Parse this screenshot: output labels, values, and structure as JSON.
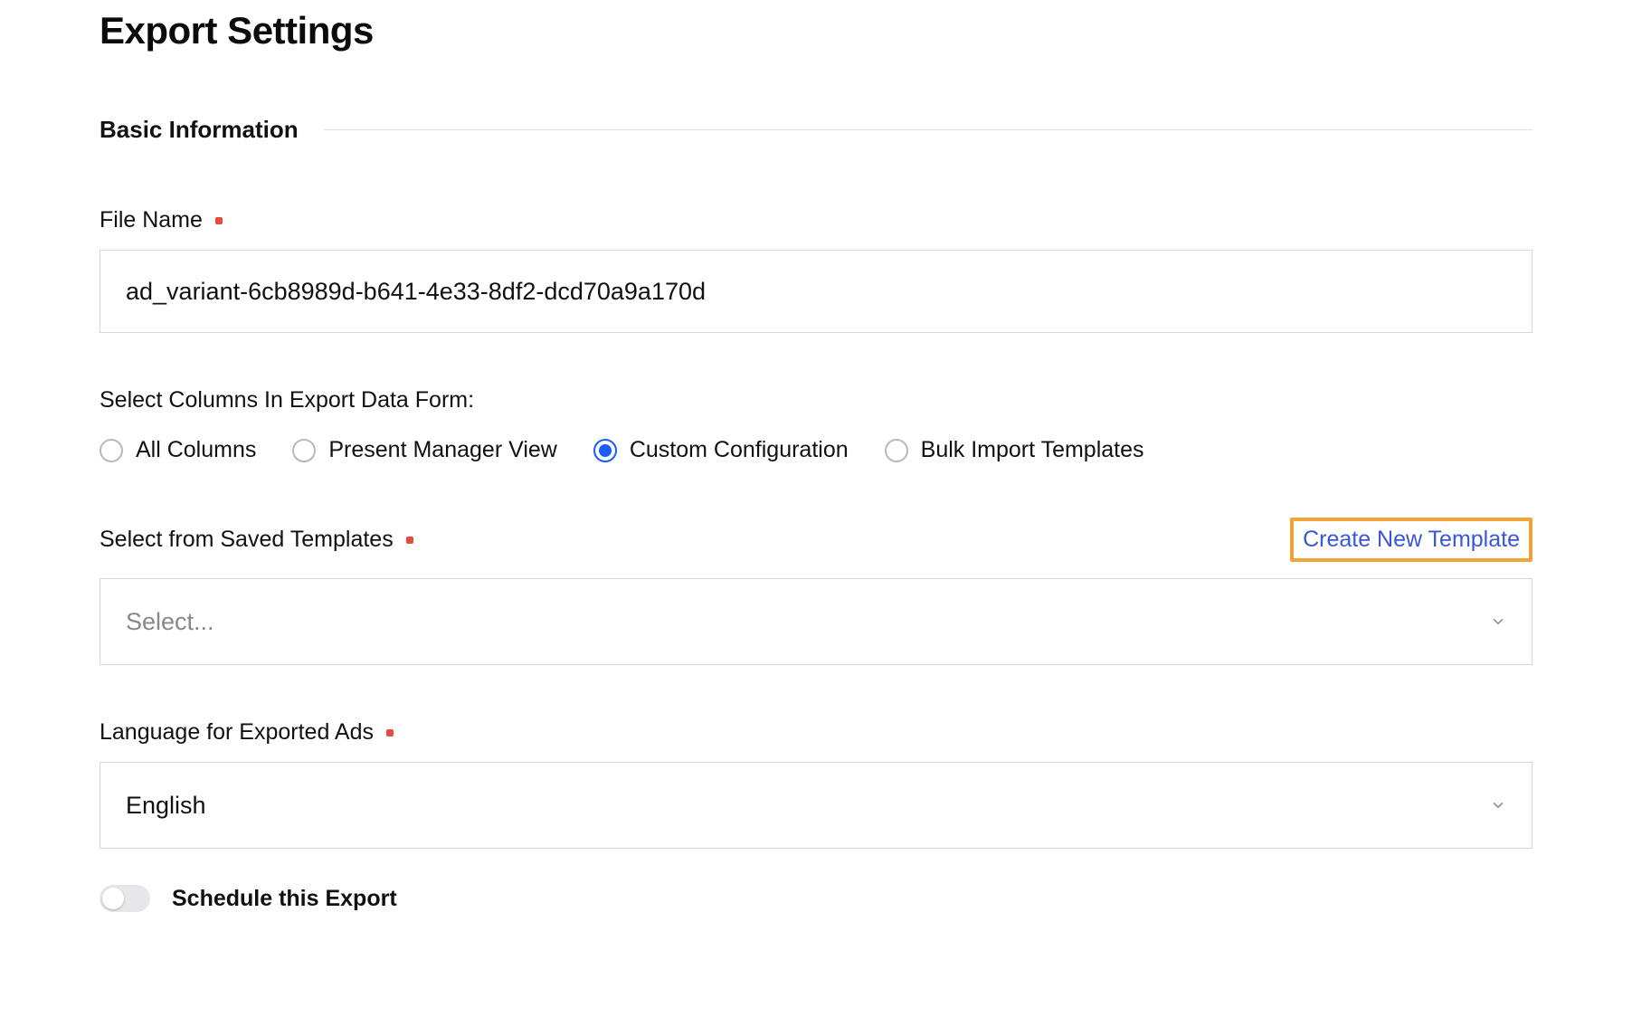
{
  "page": {
    "title": "Export Settings"
  },
  "section_basic": {
    "heading": "Basic Information"
  },
  "file_name": {
    "label": "File Name",
    "value": "ad_variant-6cb8989d-b641-4e33-8df2-dcd70a9a170d"
  },
  "columns": {
    "label": "Select Columns In Export Data Form:",
    "options": {
      "all": "All Columns",
      "present_manager": "Present Manager View",
      "custom": "Custom Configuration",
      "bulk_import": "Bulk Import Templates"
    },
    "selected": "custom"
  },
  "saved_templates": {
    "label": "Select from Saved Templates",
    "placeholder": "Select...",
    "create_link": "Create New Template"
  },
  "language": {
    "label": "Language for Exported Ads",
    "value": "English"
  },
  "schedule": {
    "label": "Schedule this Export",
    "enabled": false
  }
}
